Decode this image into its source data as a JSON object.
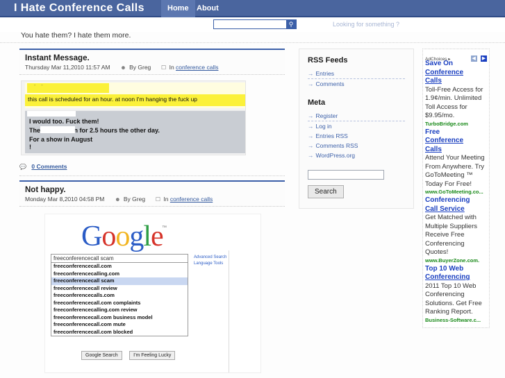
{
  "header": {
    "site_title": "I Hate Conference Calls",
    "nav": [
      {
        "label": "Home",
        "active": true
      },
      {
        "label": "About",
        "active": false
      }
    ]
  },
  "search": {
    "label": "Looking for something ?",
    "value": "",
    "placeholder": "",
    "button_icon": "search-icon"
  },
  "tagline": "You hate them? I hate them more.",
  "posts": [
    {
      "title": "Instant Message.",
      "date": "Thursday Mar 11,2010 11:57 AM",
      "by_label": "By Greg",
      "in_label": "In",
      "category": "conference calls",
      "comments": "0 Comments",
      "im_screenshot": {
        "redacted_name_1": "- -",
        "yellow_line": "this call is scheduled for an hour.  at noon I'm hanging the fuck up",
        "gray_lines": [
          "I would too.  Fuck them!",
          "The               call went on for 2.5 hours the other day.",
          "For a show in August",
          "!"
        ]
      }
    },
    {
      "title": "Not happy.",
      "date": "Monday Mar 8,2010 04:58 PM",
      "by_label": "By Greg",
      "in_label": "In",
      "category": "conference calls",
      "google_screenshot": {
        "logo": "Google",
        "tm": "™",
        "query": "freeconferencecall scam",
        "suggestions": [
          {
            "text": "freeconferencecall.com",
            "selected": false
          },
          {
            "text": "freeconferencecalling.com",
            "selected": false
          },
          {
            "text": "freeconferencecall scam",
            "selected": true
          },
          {
            "text": "freeconferencecall review",
            "selected": false
          },
          {
            "text": "freeconferencecalls.com",
            "selected": false
          },
          {
            "text": "freeconferencecall.com complaints",
            "selected": false
          },
          {
            "text": "freeconferencecalling.com review",
            "selected": false
          },
          {
            "text": "freeconferencecall.com business model",
            "selected": false
          },
          {
            "text": "freeconferencecall.com mute",
            "selected": false
          },
          {
            "text": "freeconferencecall.com blocked",
            "selected": false
          }
        ],
        "right_links": [
          "Advanced Search",
          "Language Tools"
        ],
        "buttons": [
          "Google Search",
          "I'm Feeling Lucky"
        ]
      }
    }
  ],
  "sidebar": {
    "rss_heading": "RSS Feeds",
    "rss_links": [
      "Entries",
      "Comments"
    ],
    "meta_heading": "Meta",
    "meta_links": [
      "Register",
      "Log in",
      "Entries RSS",
      "Comments RSS",
      "WordPress.org"
    ],
    "search_value": "",
    "search_placeholder": "",
    "search_button": "Search"
  },
  "ads": {
    "adchoices_label": "AdChoices",
    "adchoices_icon": "info-triangle-icon",
    "prev_icon": "◀",
    "next_icon": "▶",
    "items": [
      {
        "title_line1": "Save On",
        "title_line2": "Conference",
        "title_line3": "Calls",
        "body": "Toll-Free Access for 1.9¢/min. Unlimited Toll Access for $9.95/mo.",
        "url": "TurboBridge.com"
      },
      {
        "title_line1": "Free",
        "title_line2": "Conference",
        "title_line3": "Calls",
        "body": "Attend Your Meeting From Anywhere. Try GoToMeeting ™ Today For Free!",
        "url": "www.GoToMeeting.co..."
      },
      {
        "title_line1": "Conferencing",
        "title_line2": "Call Service",
        "title_line3": "",
        "body": "Get Matched with Multiple Suppliers Receive Free Conferencing Quotes!",
        "url": "www.BuyerZone.com."
      },
      {
        "title_line1": "Top 10 Web",
        "title_line2": "Conferencing",
        "title_line3": "",
        "body": "2011 Top 10 Web Conferencing Solutions. Get Free Ranking Report.",
        "url": "Business-Software.c..."
      }
    ]
  },
  "colors": {
    "header_blue": "#4a659e",
    "nav_active": "#5c77b0",
    "link_blue": "#32589d",
    "ad_title_blue": "#1a3fc0",
    "ad_url_green": "#1a8a1a",
    "highlight_yellow": "#fbf13a",
    "im_gray": "#c9cdd3"
  }
}
